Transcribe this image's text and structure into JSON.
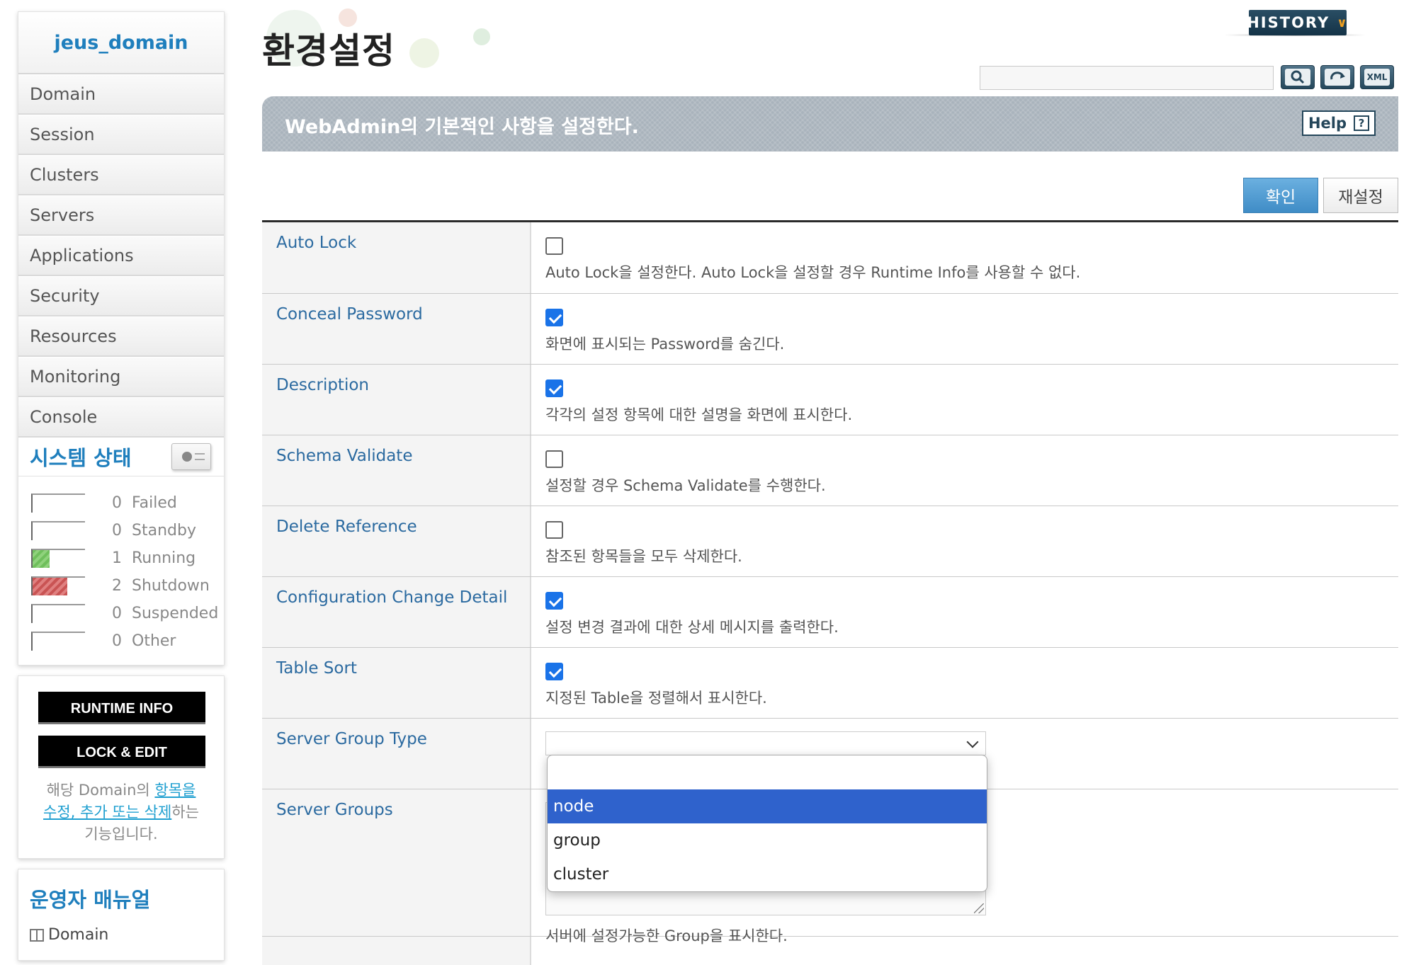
{
  "sidebar": {
    "domain_title": "jeus_domain",
    "nav": [
      "Domain",
      "Session",
      "Clusters",
      "Servers",
      "Applications",
      "Security",
      "Resources",
      "Monitoring",
      "Console"
    ],
    "status_title": "시스템 상태",
    "status": [
      {
        "count": "0",
        "label": "Failed",
        "fill": 0
      },
      {
        "count": "0",
        "label": "Standby",
        "fill": 0
      },
      {
        "count": "1",
        "label": "Running",
        "fill": 0.33
      },
      {
        "count": "2",
        "label": "Shutdown",
        "fill": 0.66
      },
      {
        "count": "0",
        "label": "Suspended",
        "fill": 0
      },
      {
        "count": "0",
        "label": "Other",
        "fill": 0
      }
    ],
    "runtime_info_label": "RUNTIME INFO",
    "lock_edit_label": "LOCK & EDIT",
    "lock_desc_pre": "해당 Domain의 ",
    "lock_desc_link": "항목을 수정, 추가 또는 삭제",
    "lock_desc_post": "하는 기능입니다.",
    "manual_title": "운영자 매뉴얼",
    "manual_link": "Domain"
  },
  "header": {
    "page_title": "환경설정",
    "history_label": "HISTORY",
    "search_placeholder": "",
    "search_value": "",
    "tool_xml_label": "XML"
  },
  "banner": {
    "text": "WebAdmin의 기본적인 사항을 설정한다.",
    "help_label": "Help"
  },
  "actions": {
    "confirm_label": "확인",
    "reset_label": "재설정"
  },
  "settings": [
    {
      "label": "Auto Lock",
      "checked": false,
      "desc": "Auto Lock을 설정한다. Auto Lock을 설정할 경우 Runtime Info를 사용할 수 없다."
    },
    {
      "label": "Conceal Password",
      "checked": true,
      "desc": "화면에 표시되는 Password를 숨긴다."
    },
    {
      "label": "Description",
      "checked": true,
      "desc": "각각의 설정 항목에 대한 설명을 화면에 표시한다."
    },
    {
      "label": "Schema Validate",
      "checked": false,
      "desc": "설정할 경우 Schema Validate를 수행한다."
    },
    {
      "label": "Delete Reference",
      "checked": false,
      "desc": "참조된 항목들을 모두 삭제한다."
    },
    {
      "label": "Configuration Change Detail",
      "checked": true,
      "desc": "설정 변경 결과에 대한 상세 메시지를 출력한다."
    },
    {
      "label": "Table Sort",
      "checked": true,
      "desc": "지정된 Table을 정렬해서 표시한다."
    }
  ],
  "server_group_type": {
    "label": "Server Group Type",
    "selected_value": "",
    "options": [
      "",
      "node",
      "group",
      "cluster"
    ],
    "highlighted": "node"
  },
  "server_groups": {
    "label": "Server Groups",
    "desc": "서버에 설정가능한 Group을 표시한다."
  },
  "colors": {
    "accent_blue": "#1f7fbd",
    "label_blue": "#2b6aa0",
    "checkbox_blue": "#1a73e8",
    "dropdown_selected": "#2f62cc",
    "status_running": "#6fbf5c",
    "status_shutdown": "#c95454"
  }
}
